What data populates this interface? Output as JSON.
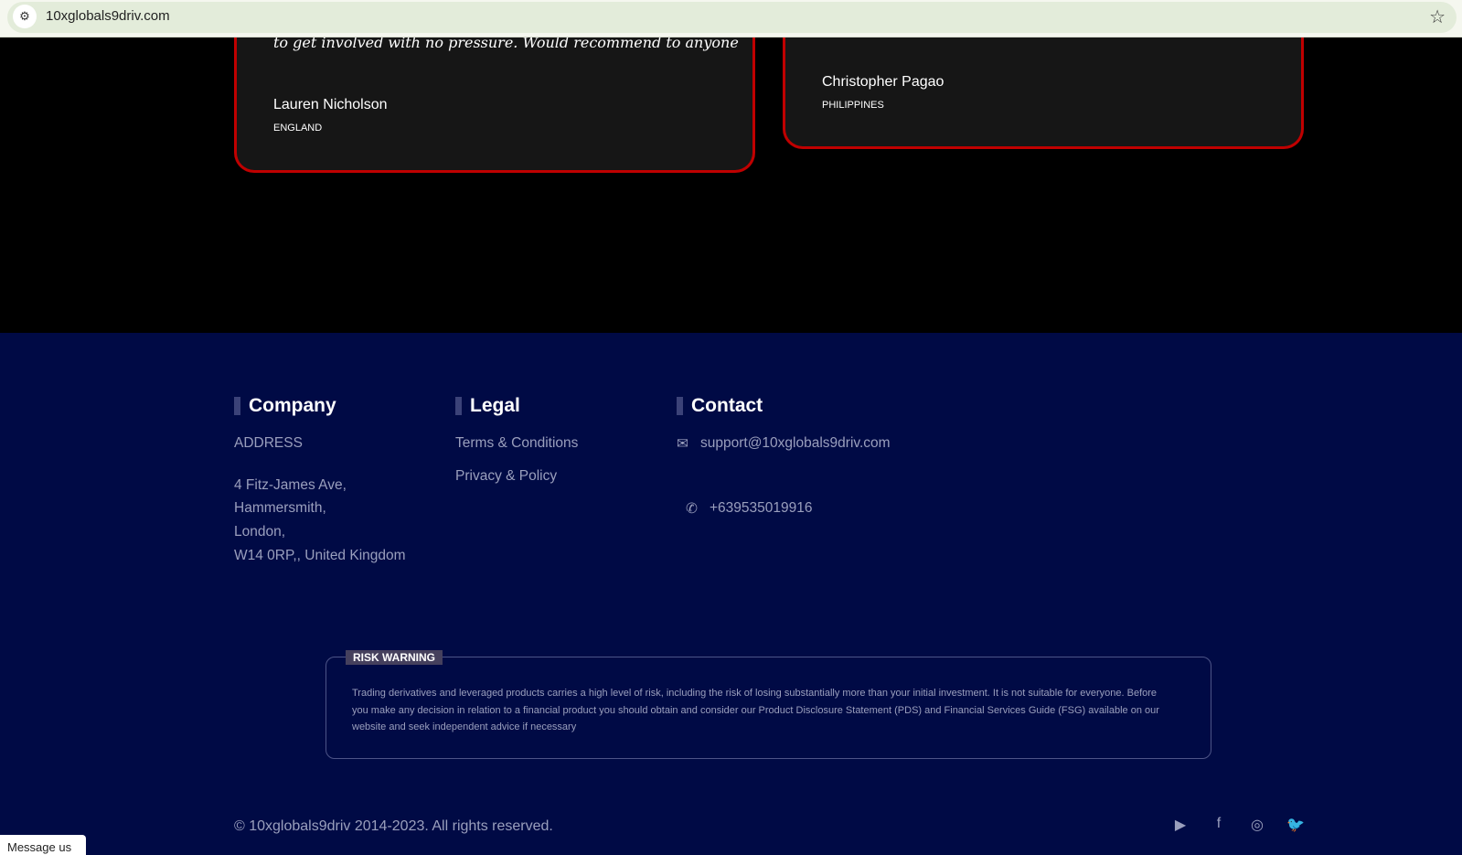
{
  "browser": {
    "url": "10xglobals9driv.com"
  },
  "testimonials": [
    {
      "quote": "to get involved with no pressure. Would recommend to anyone",
      "name": "Lauren Nicholson",
      "country": "ENGLAND"
    },
    {
      "name": "Christopher Pagao",
      "country": "PHILIPPINES"
    }
  ],
  "footer": {
    "company": {
      "heading": "Company",
      "address_label": "ADDRESS",
      "address_lines": [
        "4 Fitz-James Ave,",
        "Hammersmith,",
        "London,",
        "W14 0RP,, United Kingdom"
      ]
    },
    "legal": {
      "heading": "Legal",
      "links": [
        "Terms & Conditions",
        "Privacy & Policy"
      ]
    },
    "contact": {
      "heading": "Contact",
      "email": "support@10xglobals9driv.com",
      "phone": "+639535019916"
    },
    "risk": {
      "label": "RISK WARNING",
      "text": "Trading derivatives and leveraged products carries a high level of risk, including the risk of losing substantially more than your initial investment. It is not suitable for everyone. Before you make any decision in relation to a financial product you should obtain and consider our Product Disclosure Statement (PDS) and Financial Services Guide (FSG) available on our website and seek independent advice if necessary"
    },
    "copyright": "© 10xglobals9driv 2014-2023. All rights reserved.",
    "social": [
      "youtube-icon",
      "facebook-icon",
      "instagram-icon",
      "twitter-icon"
    ]
  },
  "chat": {
    "label": "Message us"
  }
}
